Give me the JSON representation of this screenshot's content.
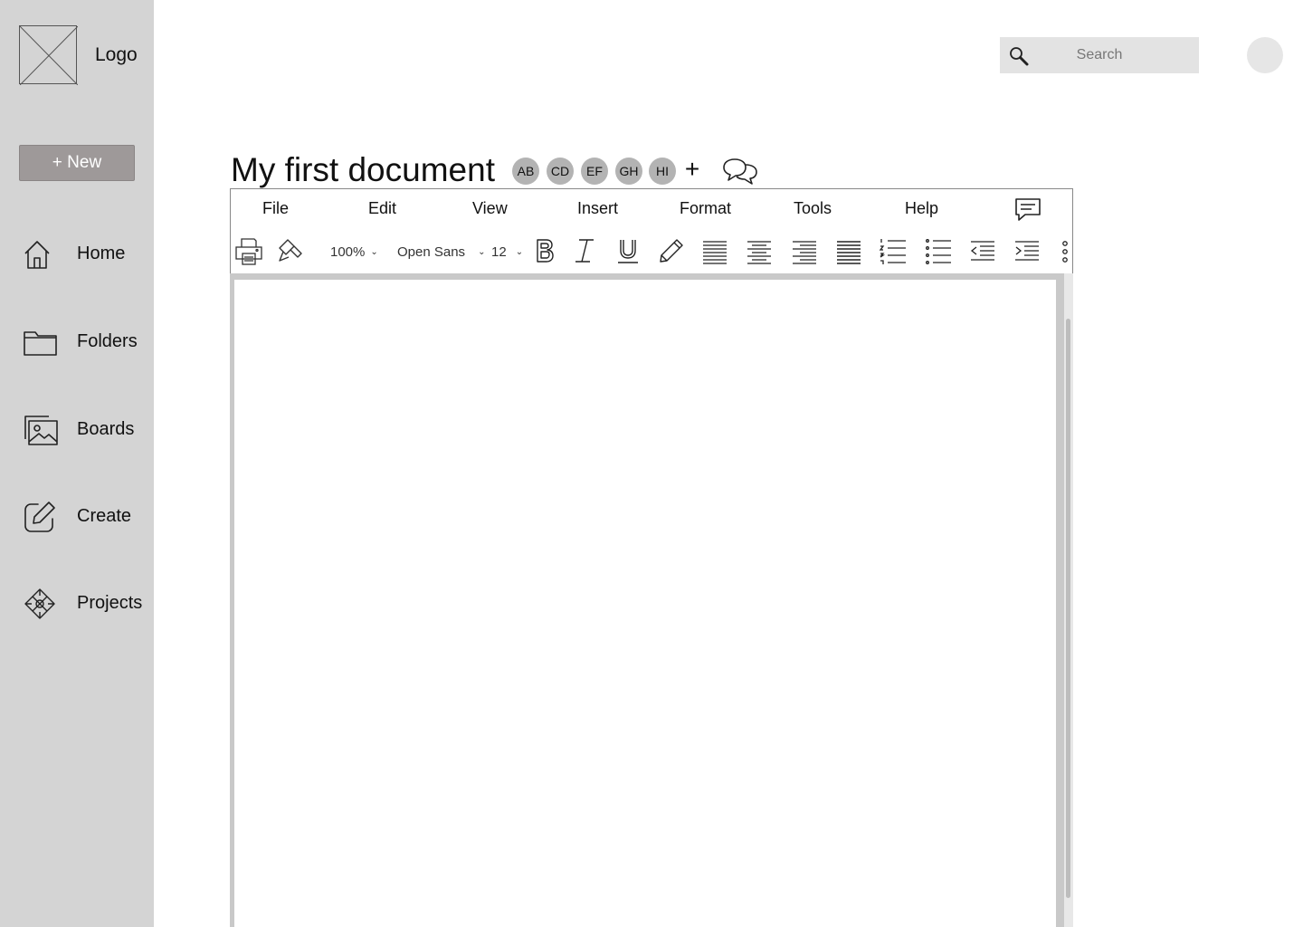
{
  "sidebar": {
    "logo_label": "Logo",
    "new_button": "+ New",
    "items": [
      {
        "label": "Home",
        "icon": "home-icon"
      },
      {
        "label": "Folders",
        "icon": "folder-icon"
      },
      {
        "label": "Boards",
        "icon": "image-icon"
      },
      {
        "label": "Create",
        "icon": "edit-icon"
      },
      {
        "label": "Projects",
        "icon": "projects-icon"
      }
    ]
  },
  "header": {
    "search": {
      "placeholder": "Search",
      "icon": "search-icon"
    },
    "avatar": "user-avatar"
  },
  "document": {
    "title": "My first document",
    "collaborators": [
      "AB",
      "CD",
      "EF",
      "GH",
      "HI"
    ],
    "add_collaborator": "+"
  },
  "menubar": {
    "items": [
      "File",
      "Edit",
      "View",
      "Insert",
      "Format",
      "Tools",
      "Help"
    ]
  },
  "toolbar": {
    "zoom": "100%",
    "font": "Open Sans",
    "font_size": "12"
  },
  "colors": {
    "sidebar_bg": "#d4d4d4",
    "new_button_bg": "#9e9999",
    "collaborator_bg": "#b3b3b3",
    "search_bg": "#e3e3e3"
  }
}
